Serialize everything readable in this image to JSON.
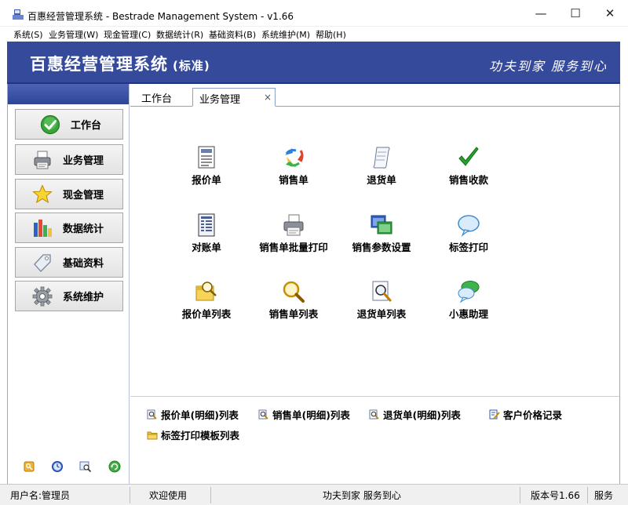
{
  "window": {
    "title": "百惠经营管理系统 - Bestrade Management System - v1.66",
    "minimize": "—",
    "maximize": "☐",
    "close": "✕"
  },
  "menu": {
    "items": [
      {
        "label": "系统(S)"
      },
      {
        "label": "业务管理(W)"
      },
      {
        "label": "现金管理(C)"
      },
      {
        "label": "数据统计(R)"
      },
      {
        "label": "基础资料(B)"
      },
      {
        "label": "系统维护(M)"
      },
      {
        "label": "帮助(H)"
      }
    ]
  },
  "banner": {
    "title": "百惠经营管理系统",
    "edition": "(标准)",
    "slogan": "功夫到家 服务到心",
    "color": "#354a9b"
  },
  "sidebar": {
    "items": [
      {
        "label": "工作台",
        "icon": "check-circle-icon"
      },
      {
        "label": "业务管理",
        "icon": "printer-icon"
      },
      {
        "label": "现金管理",
        "icon": "star-icon"
      },
      {
        "label": "数据统计",
        "icon": "bar-chart-icon"
      },
      {
        "label": "基础资料",
        "icon": "tag-icon"
      },
      {
        "label": "系统维护",
        "icon": "gear-icon"
      }
    ],
    "tools": [
      {
        "icon": "key-icon"
      },
      {
        "icon": "clock-icon"
      },
      {
        "icon": "search-window-icon"
      },
      {
        "icon": "refresh-icon"
      }
    ]
  },
  "tabs": {
    "workbench": "工作台",
    "business": "业务管理",
    "close": "×"
  },
  "functions": [
    {
      "label": "报价单",
      "icon": "document-icon"
    },
    {
      "label": "销售单",
      "icon": "recycle-arrows-icon"
    },
    {
      "label": "退货单",
      "icon": "scroll-icon"
    },
    {
      "label": "销售收款",
      "icon": "checkmark-icon"
    },
    {
      "label": "对账单",
      "icon": "ledger-icon"
    },
    {
      "label": "销售单批量打印",
      "icon": "printer-icon"
    },
    {
      "label": "销售参数设置",
      "icon": "windows-icon"
    },
    {
      "label": "标签打印",
      "icon": "speech-bubble-icon"
    },
    {
      "label": "报价单列表",
      "icon": "document-search-icon"
    },
    {
      "label": "销售单列表",
      "icon": "magnifier-icon"
    },
    {
      "label": "退货单列表",
      "icon": "page-search-icon"
    },
    {
      "label": "小惠助理",
      "icon": "chat-bubbles-icon"
    }
  ],
  "quick_links": [
    {
      "label": "报价单(明细)列表",
      "icon": "search-doc-icon"
    },
    {
      "label": "销售单(明细)列表",
      "icon": "search-doc-icon"
    },
    {
      "label": "退货单(明细)列表",
      "icon": "search-doc-icon"
    },
    {
      "label": "客户价格记录",
      "icon": "edit-doc-icon"
    },
    {
      "label": "标签打印模板列表",
      "icon": "folder-icon"
    }
  ],
  "status": {
    "user": "用户名:管理员",
    "welcome": "欢迎使用",
    "slogan": "功夫到家 服务到心",
    "version": "版本号1.66",
    "extra": "服务"
  }
}
